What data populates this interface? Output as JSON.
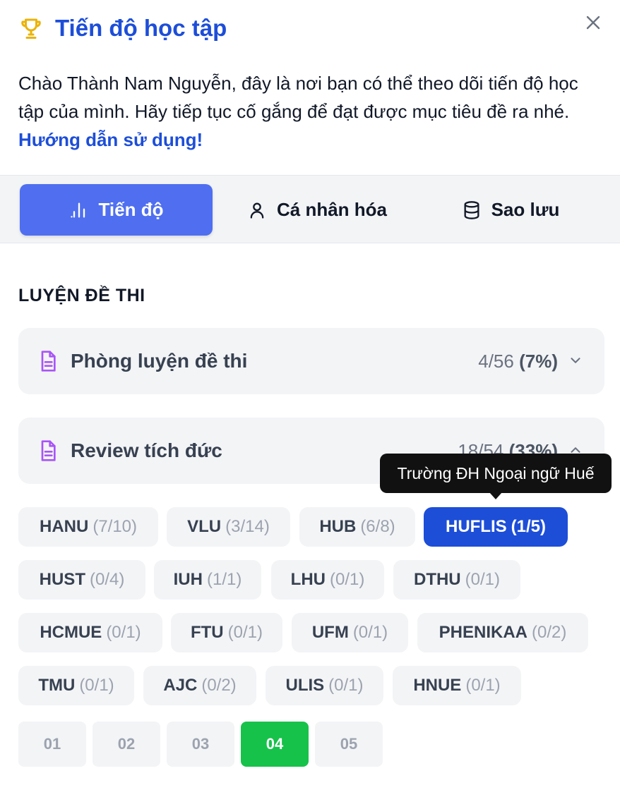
{
  "header": {
    "title": "Tiến độ học tập",
    "icon": "trophy-icon",
    "close_icon": "close-icon",
    "accent_color": "#1d4ed8"
  },
  "intro": {
    "text": "Chào Thành Nam Nguyễn, đây là nơi bạn có thể theo dõi tiến độ học tập của mình. Hãy tiếp tục cố gắng để đạt được mục tiêu đề ra nhé. ",
    "link": "Hướng dẫn sử dụng!"
  },
  "tabs": [
    {
      "label": "Tiến độ",
      "icon": "bar-chart-icon",
      "active": true
    },
    {
      "label": "Cá nhân hóa",
      "icon": "user-icon",
      "active": false
    },
    {
      "label": "Sao lưu",
      "icon": "database-icon",
      "active": false
    }
  ],
  "section": {
    "title": "LUYỆN ĐỀ THI"
  },
  "cards": [
    {
      "label": "Phòng luyện đề thi",
      "count": "4/56",
      "percent": "(7%)",
      "icon": "document-icon",
      "expanded": false
    },
    {
      "label": "Review tích đức",
      "count": "18/54",
      "percent": "(33%)",
      "icon": "document-icon",
      "expanded": true
    }
  ],
  "tooltip": {
    "text": "Trường ĐH Ngoại ngữ Huế"
  },
  "chips": [
    {
      "name": "HANU",
      "count": "(7/10)"
    },
    {
      "name": "VLU",
      "count": "(3/14)"
    },
    {
      "name": "HUB",
      "count": "(6/8)"
    },
    {
      "name": "HUFLIS",
      "count": "(1/5)",
      "selected": true
    },
    {
      "name": "HUST",
      "count": "(0/4)"
    },
    {
      "name": "IUH",
      "count": "(1/1)"
    },
    {
      "name": "LHU",
      "count": "(0/1)"
    },
    {
      "name": "DTHU",
      "count": "(0/1)"
    },
    {
      "name": "HCMUE",
      "count": "(0/1)"
    },
    {
      "name": "FTU",
      "count": "(0/1)"
    },
    {
      "name": "UFM",
      "count": "(0/1)"
    },
    {
      "name": "PHENIKAA",
      "count": "(0/2)"
    },
    {
      "name": "TMU",
      "count": "(0/1)"
    },
    {
      "name": "AJC",
      "count": "(0/2)"
    },
    {
      "name": "ULIS",
      "count": "(0/1)"
    },
    {
      "name": "HNUE",
      "count": "(0/1)"
    }
  ],
  "numbers": [
    {
      "label": "01"
    },
    {
      "label": "02"
    },
    {
      "label": "03"
    },
    {
      "label": "04",
      "selected": true
    },
    {
      "label": "05"
    }
  ],
  "colors": {
    "primary": "#4f6ff0",
    "selected_chip": "#1d4ed8",
    "selected_number": "#16c24a",
    "doc_icon": "#a855f7"
  }
}
